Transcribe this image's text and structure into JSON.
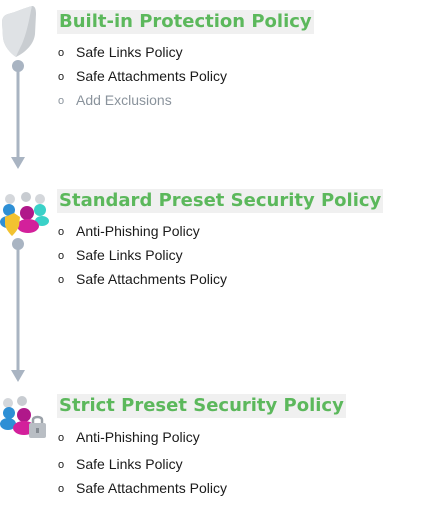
{
  "colors": {
    "title": "#5cb85c",
    "title_bg": "#f0f0f0",
    "connector": "#a9b4c2",
    "muted_text": "#8a939c"
  },
  "sections": [
    {
      "icon": "shield-icon",
      "title": "Built-in Protection Policy",
      "items": [
        {
          "bullet": "o",
          "label": "Safe Links Policy"
        },
        {
          "bullet": "o",
          "label": "Safe Attachments Policy"
        },
        {
          "bullet": "o",
          "label": "Add Exclusions"
        }
      ]
    },
    {
      "icon": "user-group-shield-icon",
      "title": "Standard Preset Security Policy",
      "items": [
        {
          "bullet": "o",
          "label": "Anti-Phishing Policy"
        },
        {
          "bullet": "o",
          "label": "Safe Links Policy"
        },
        {
          "bullet": "o",
          "label": "Safe Attachments Policy"
        }
      ]
    },
    {
      "icon": "user-lock-icon",
      "title": "Strict Preset Security Policy",
      "items": [
        {
          "bullet": "o",
          "label": "Anti-Phishing Policy"
        },
        {
          "bullet": "o",
          "label": "Safe Links Policy"
        },
        {
          "bullet": "o",
          "label": "Safe Attachments Policy"
        }
      ]
    }
  ]
}
